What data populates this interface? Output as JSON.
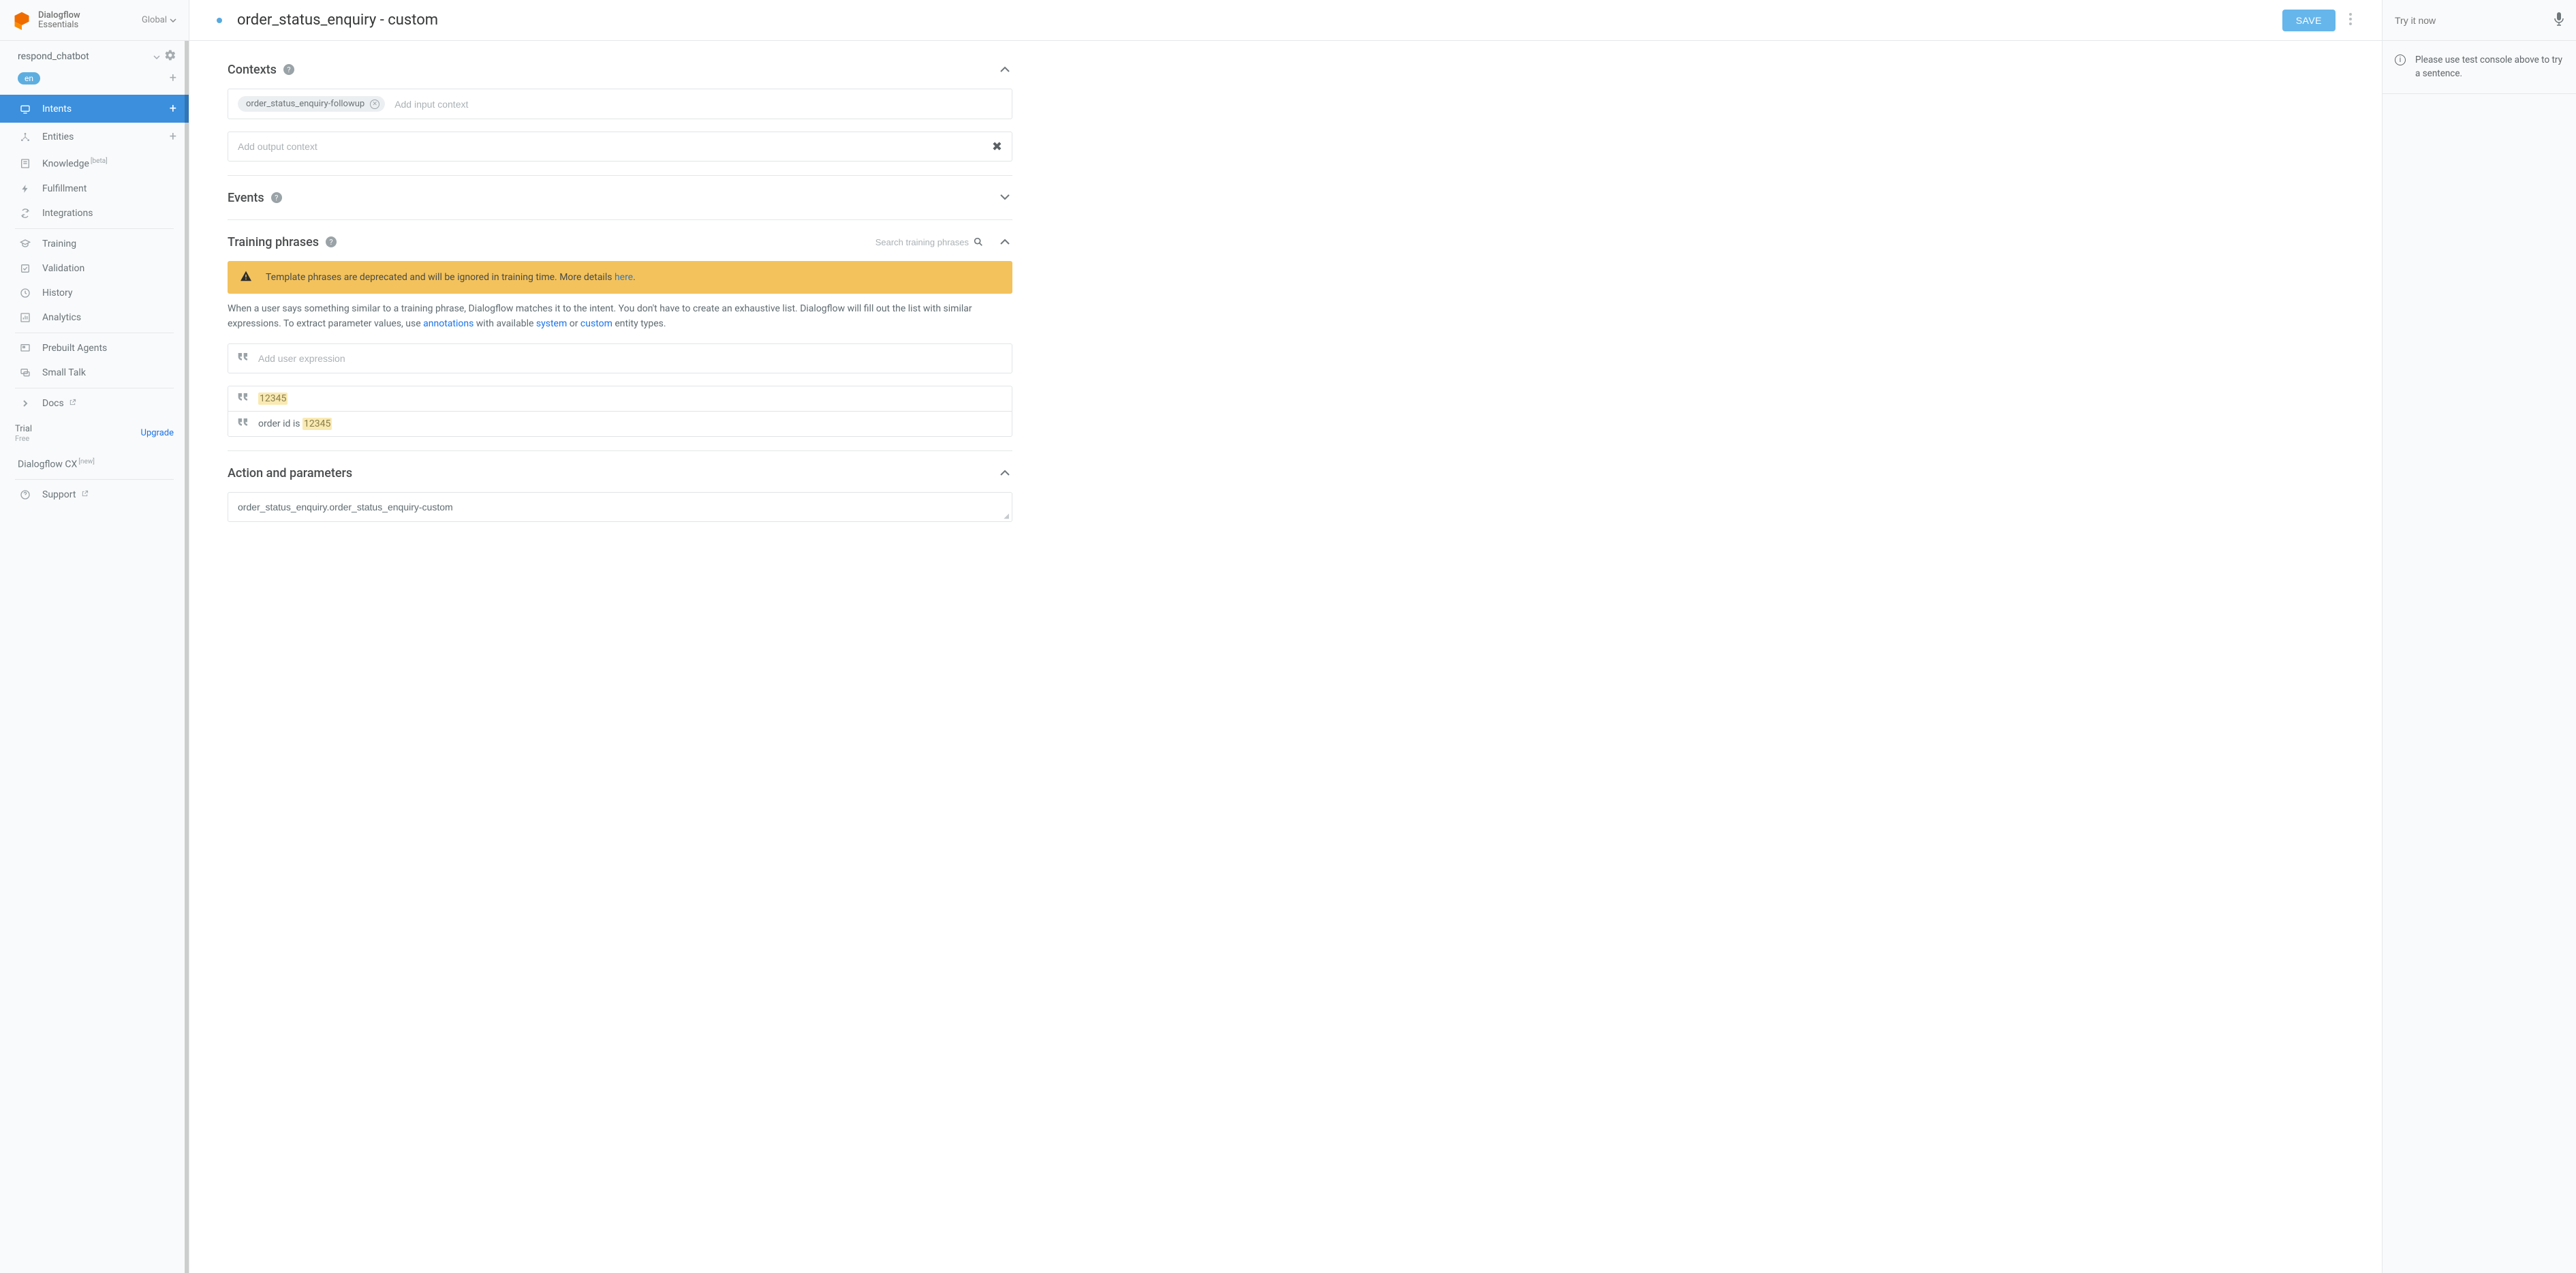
{
  "brand": {
    "line1": "Dialogflow",
    "line2": "Essentials",
    "global": "Global"
  },
  "agent": {
    "name": "respond_chatbot",
    "lang": "en"
  },
  "nav": {
    "intents": "Intents",
    "entities": "Entities",
    "knowledge": "Knowledge",
    "knowledge_badge": "[beta]",
    "fulfillment": "Fulfillment",
    "integrations": "Integrations",
    "training": "Training",
    "validation": "Validation",
    "history": "History",
    "analytics": "Analytics",
    "prebuilt": "Prebuilt Agents",
    "smalltalk": "Small Talk",
    "docs": "Docs",
    "cx": "Dialogflow CX",
    "cx_badge": "[new]",
    "support": "Support"
  },
  "trial": {
    "label": "Trial",
    "plan": "Free",
    "upgrade": "Upgrade"
  },
  "header": {
    "title": "order_status_enquiry - custom",
    "save": "SAVE"
  },
  "sections": {
    "contexts": "Contexts",
    "events": "Events",
    "training": "Training phrases",
    "action": "Action and parameters"
  },
  "contexts": {
    "input_chip": "order_status_enquiry-followup",
    "input_placeholder": "Add input context",
    "output_placeholder": "Add output context"
  },
  "training": {
    "search_placeholder": "Search training phrases",
    "warning_prefix": "Template phrases are deprecated and will be ignored in training time. More details ",
    "warning_link": "here",
    "explain_1": "When a user says something similar to a training phrase, Dialogflow matches it to the intent. You don't have to create an exhaustive list. Dialogflow will fill out the list with similar expressions. To extract parameter values, use ",
    "link_annotations": "annotations",
    "explain_2": " with available ",
    "link_system": "system",
    "explain_3": " or ",
    "link_custom": "custom",
    "explain_4": " entity types.",
    "add_placeholder": "Add user expression",
    "phrases": [
      {
        "prefix": "",
        "entity": "12345"
      },
      {
        "prefix": "order id is ",
        "entity": "12345"
      }
    ]
  },
  "action": {
    "name_value": "order_status_enquiry.order_status_enquiry-custom"
  },
  "tryit": {
    "placeholder": "Try it now",
    "message": "Please use test console above to try a sentence."
  }
}
